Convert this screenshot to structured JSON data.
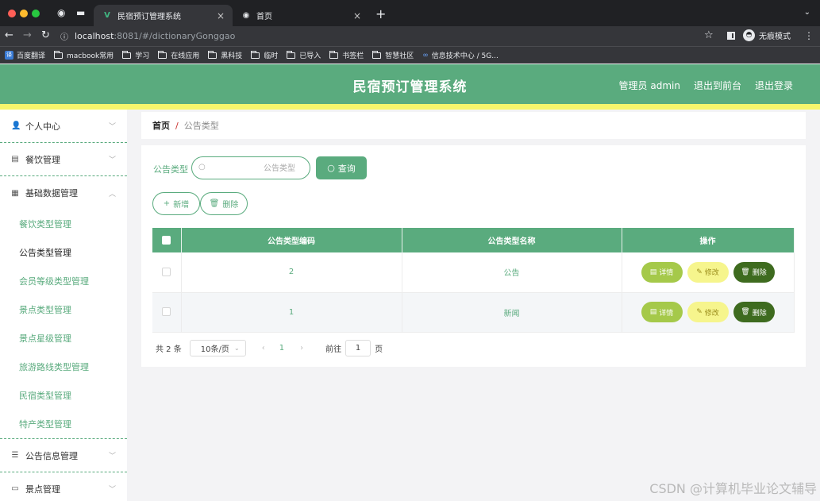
{
  "browser": {
    "tabs": [
      {
        "title": "民宿预订管理系统",
        "favicon": "vue-logo-icon",
        "active": true
      },
      {
        "title": "首页",
        "favicon": "globe-icon",
        "active": false
      }
    ],
    "url": {
      "host": "localhost",
      "rest": ":8081/#/dictionaryGonggao"
    },
    "incognito_label": "无痕模式",
    "bookmarks": [
      {
        "label": "百度翻译",
        "icon": "translate-badge-icon"
      },
      {
        "label": "macbook常用",
        "icon": "folder-icon"
      },
      {
        "label": "学习",
        "icon": "folder-icon"
      },
      {
        "label": "在线应用",
        "icon": "folder-icon"
      },
      {
        "label": "黑科技",
        "icon": "folder-icon"
      },
      {
        "label": "临时",
        "icon": "folder-icon"
      },
      {
        "label": "已导入",
        "icon": "folder-icon"
      },
      {
        "label": "书签栏",
        "icon": "folder-icon"
      },
      {
        "label": "智慧社区",
        "icon": "folder-icon"
      },
      {
        "label": "信息技术中心 / 5G...",
        "icon": "link-icon"
      }
    ]
  },
  "header": {
    "title": "民宿预订管理系统",
    "admin_label": "管理员 admin",
    "front_link": "退出到前台",
    "logout_link": "退出登录",
    "color": "#5aab7e",
    "stripe_color": "#f5f56c"
  },
  "sidebar": {
    "groups": [
      {
        "label": "个人中心",
        "icon": "user-icon",
        "expanded": false
      },
      {
        "label": "餐饮管理",
        "icon": "cup-icon",
        "expanded": false
      },
      {
        "label": "基础数据管理",
        "icon": "grid-icon",
        "expanded": true,
        "items": [
          {
            "label": "餐饮类型管理",
            "active": false
          },
          {
            "label": "公告类型管理",
            "active": true
          },
          {
            "label": "会员等级类型管理",
            "active": false
          },
          {
            "label": "景点类型管理",
            "active": false
          },
          {
            "label": "景点星级管理",
            "active": false
          },
          {
            "label": "旅游路线类型管理",
            "active": false
          },
          {
            "label": "民宿类型管理",
            "active": false
          },
          {
            "label": "特产类型管理",
            "active": false
          }
        ]
      },
      {
        "label": "公告信息管理",
        "icon": "list-icon",
        "expanded": false
      },
      {
        "label": "景点管理",
        "icon": "monitor-icon",
        "expanded": false
      }
    ]
  },
  "breadcrumb": {
    "home": "首页",
    "separator": "/",
    "current": "公告类型"
  },
  "search": {
    "label": "公告类型",
    "placeholder": "公告类型",
    "value": "",
    "button_label": "查询"
  },
  "actions": {
    "add_label": "新增",
    "delete_label": "删除"
  },
  "table": {
    "columns": [
      "公告类型编码",
      "公告类型名称",
      "操作"
    ],
    "rows": [
      {
        "code": "2",
        "name": "公告"
      },
      {
        "code": "1",
        "name": "新闻"
      }
    ],
    "row_actions": {
      "detail": "详情",
      "edit": "修改",
      "delete": "删除"
    }
  },
  "pagination": {
    "total_text": "共 2 条",
    "page_size": "10条/页",
    "current_page": "1",
    "jump_label": "前往",
    "jump_value": "1",
    "jump_suffix": "页"
  },
  "watermark": "CSDN @计算机毕业论文辅导"
}
